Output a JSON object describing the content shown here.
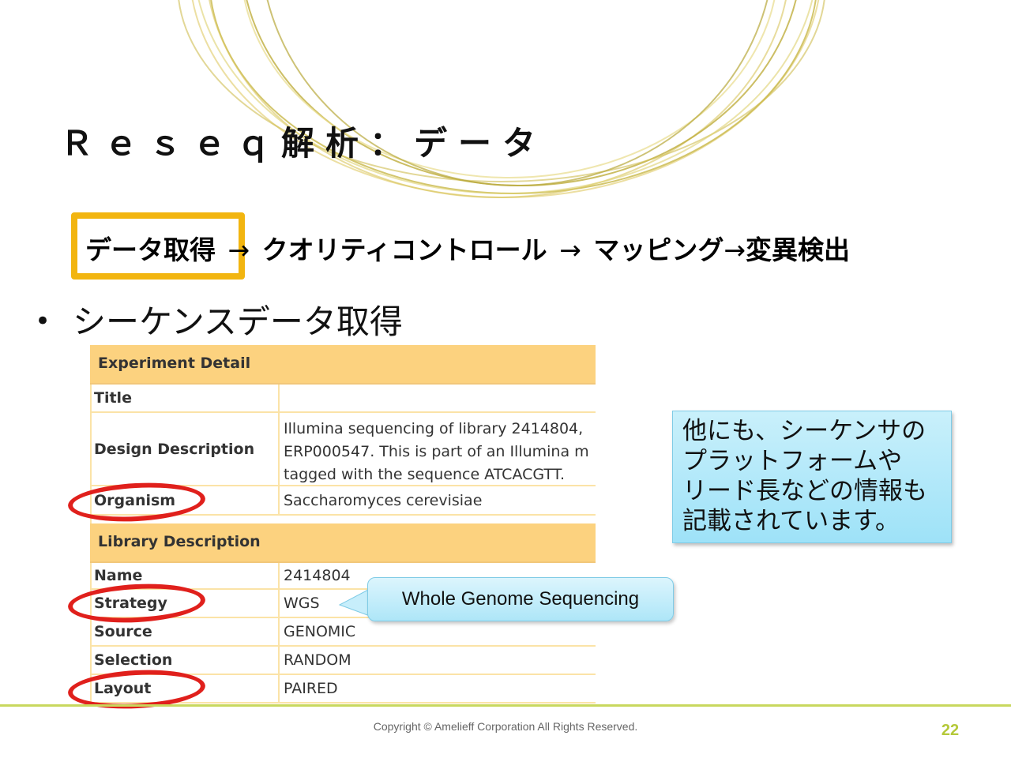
{
  "slide": {
    "title": "Ｒｅｓｅｑ解析：データ",
    "flow": {
      "steps": [
        "データ取得",
        "クオリティコントロール",
        "マッピング",
        "変異検出"
      ],
      "arrow": "→"
    },
    "bullet": "シーケンスデータ取得"
  },
  "table": {
    "experiment_header": "Experiment Detail",
    "experiment_rows": [
      {
        "label": "Title",
        "value": ""
      },
      {
        "label": "Design Description",
        "lines": [
          "Illumina sequencing of library 2414804,",
          "ERP000547. This is part of an Illumina m",
          "tagged with the sequence ATCACGTT."
        ]
      },
      {
        "label": "Organism",
        "value": "Saccharomyces cerevisiae"
      }
    ],
    "library_header": "Library Description",
    "library_rows": [
      {
        "label": "Name",
        "value": "2414804"
      },
      {
        "label": "Strategy",
        "value": "WGS"
      },
      {
        "label": "Source",
        "value": "GENOMIC"
      },
      {
        "label": "Selection",
        "value": "RANDOM"
      },
      {
        "label": "Layout",
        "value": "PAIRED"
      }
    ]
  },
  "info_box": {
    "lines": [
      "他にも、シーケンサの",
      "プラットフォームや",
      "リード長などの情報も",
      "記載されています。"
    ]
  },
  "callout": {
    "text": "Whole Genome Sequencing"
  },
  "footer": {
    "copyright": "Copyright © Amelieff Corporation All Rights Reserved.",
    "page_number": "22"
  },
  "colors": {
    "highlight": "#f2b510",
    "table_header": "#fcd27f",
    "ring": "#e0201c",
    "accent": "#b5c93a"
  }
}
